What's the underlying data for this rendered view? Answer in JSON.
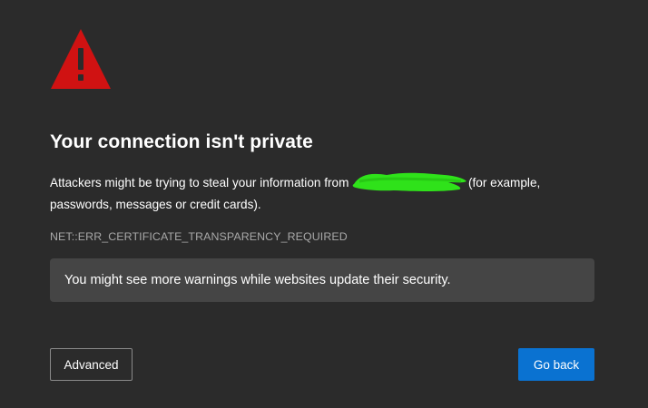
{
  "page": {
    "background": "#2b2b2b"
  },
  "icon": {
    "name": "warning-triangle-icon",
    "color": "#d01212"
  },
  "title": "Your connection isn't private",
  "description": {
    "before": "Attackers might be trying to steal your information from ",
    "after": " (for example, passwords, messages or credit cards).",
    "redaction_color": "#2fe21a"
  },
  "error_code": "NET::ERR_CERTIFICATE_TRANSPARENCY_REQUIRED",
  "notice": "You might see more warnings while websites update their security.",
  "buttons": {
    "advanced_label": "Advanced",
    "go_back_label": "Go back",
    "go_back_color": "#0a72d1"
  }
}
